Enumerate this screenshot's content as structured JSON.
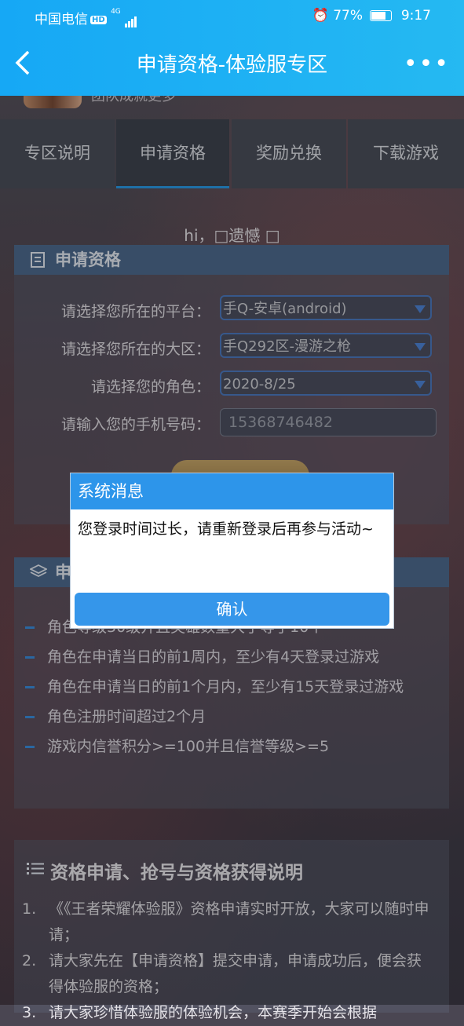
{
  "status_bar": {
    "carrier": "中国电信",
    "hd": "HD",
    "network": "4G",
    "battery_pct": "77%",
    "time": "9:17"
  },
  "header": {
    "title": "申请资格-体验服专区"
  },
  "profile": {
    "text": "团队成就更多"
  },
  "tabs": [
    {
      "label": "专区说明"
    },
    {
      "label": "申请资格"
    },
    {
      "label": "奖励兑换"
    },
    {
      "label": "下载游戏"
    }
  ],
  "greeting": "hi，□遗憾 □",
  "apply_panel": {
    "title": "申请资格",
    "platform": {
      "label": "请选择您所在的平台：",
      "value": "手Q-安卓(android)"
    },
    "region": {
      "label": "请选择您所在的大区：",
      "value": "手Q292区-漫游之枪"
    },
    "role": {
      "label": "请选择您的角色：",
      "value": "2020-8/25"
    },
    "phone": {
      "label": "请输入您的手机号码：",
      "value": "15368746482"
    }
  },
  "requirements_panel": {
    "title": "申",
    "items": [
      "角色等级30级并且英雄数量大于等于10个",
      "角色在申请当日的前1周内，至少有4天登录过游戏",
      "角色在申请当日的前1个月内，至少有15天登录过游戏",
      "角色注册时间超过2个月",
      "游戏内信誉积分>=100并且信誉等级>=5"
    ]
  },
  "info_panel": {
    "title": "资格申请、抢号与资格获得说明",
    "items": [
      {
        "num": "1.",
        "text": "《《王者荣耀体验服》资格申请实时开放，大家可以随时申请；"
      },
      {
        "num": "2.",
        "text": "请大家先在【申请资格】提交申请，申请成功后，便会获得体验服的资格；"
      },
      {
        "num": "3.",
        "text": "请大家珍惜体验服的体验机会，本赛季开始会根据"
      }
    ]
  },
  "dialog": {
    "title": "系统消息",
    "message": "您登录时间过长，请重新登录后再参与活动~",
    "confirm": "确认"
  }
}
